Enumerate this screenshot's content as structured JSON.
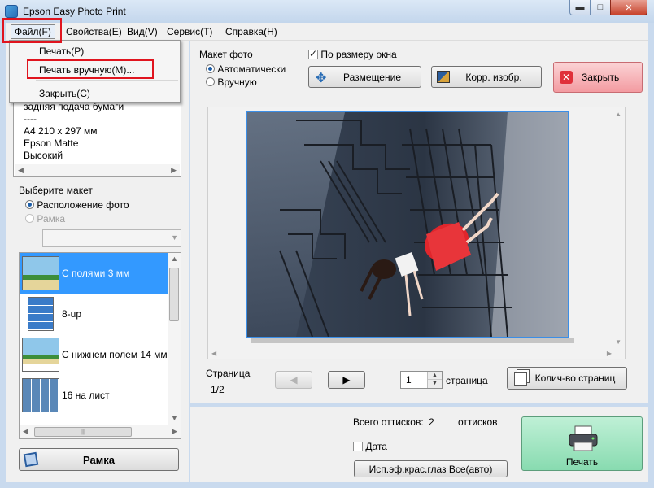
{
  "window": {
    "title": "Epson Easy Photo Print"
  },
  "titlebar": {
    "minimize": "▬",
    "maximize": "□",
    "close": "✕"
  },
  "menu": {
    "file": "Файл(F)",
    "properties": "Свойства(E)",
    "view": "Вид(V)",
    "service": "Сервис(T)",
    "help": "Справка(H)"
  },
  "file_menu": {
    "items": [
      "Печать(P)",
      "Печать вручную(M)...",
      "Закрыть(C)"
    ]
  },
  "paper_info": {
    "lines": [
      "задняя подача бумаги",
      "----",
      "A4 210 x 297 мм",
      "Epson Matte",
      "Высокий"
    ]
  },
  "layout_select": {
    "heading": "Выберите макет",
    "option_photo": "Расположение фото",
    "option_frame": "Рамка",
    "combo_value": ""
  },
  "layout_list": {
    "items": [
      "С полями 3 мм",
      "8-up",
      "С нижнем полем 14 мм",
      "16 на лист"
    ],
    "selected_index": 0
  },
  "frame_button": {
    "label": "Рамка"
  },
  "photo_layout": {
    "heading": "Макет фото",
    "auto": "Автоматически",
    "manual": "Вручную",
    "fit_window": "По размеру окна"
  },
  "toolbar": {
    "placement": "Размещение",
    "correct": "Корр. изобр.",
    "close": "Закрыть"
  },
  "paging": {
    "page_label": "Страница",
    "page_value": "1/2",
    "spin_value": "1",
    "page_suffix": "страница",
    "pages_button": "Колич-во страниц"
  },
  "print_panel": {
    "total_label": "Всего оттисков:",
    "total_value": "2",
    "total_unit": "оттисков",
    "date_label": "Дата",
    "redeye_button": "Исп.эф.крас.глаз Все(авто)",
    "print_button": "Печать"
  },
  "colors": {
    "accent": "#3399ff",
    "highlight_red": "#e0141e",
    "print_green": "#88dbb0",
    "close_red": "#f39ba1"
  }
}
